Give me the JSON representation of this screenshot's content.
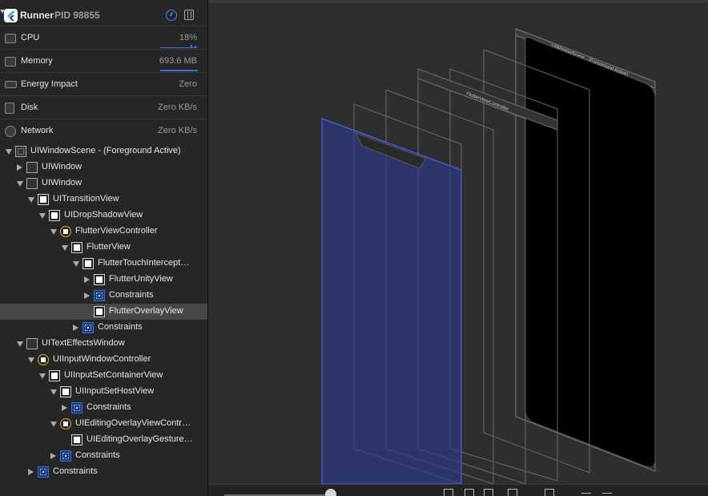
{
  "process": {
    "app_name": "Runner",
    "pid": "PID 98855",
    "app_icon": "flutter-icon"
  },
  "gauges": [
    {
      "name": "CPU",
      "value": "18%",
      "icon": "cpu-icon"
    },
    {
      "name": "Memory",
      "value": "693.6 MB",
      "icon": "memory-icon"
    },
    {
      "name": "Energy Impact",
      "value": "Zero",
      "icon": "battery-icon"
    },
    {
      "name": "Disk",
      "value": "Zero KB/s",
      "icon": "disk-icon"
    },
    {
      "name": "Network",
      "value": "Zero KB/s",
      "icon": "network-icon"
    }
  ],
  "tree": [
    {
      "label": "UIWindowScene - (Foreground Active)",
      "depth": 0,
      "disclosure": "down",
      "icon": "scene"
    },
    {
      "label": "UIWindow",
      "depth": 1,
      "disclosure": "right",
      "icon": "window"
    },
    {
      "label": "UIWindow",
      "depth": 1,
      "disclosure": "down",
      "icon": "window"
    },
    {
      "label": "UITransitionView",
      "depth": 2,
      "disclosure": "down",
      "icon": "view"
    },
    {
      "label": "UIDropShadowView",
      "depth": 3,
      "disclosure": "down",
      "icon": "view"
    },
    {
      "label": "FlutterViewController",
      "depth": 4,
      "disclosure": "down",
      "icon": "vc"
    },
    {
      "label": "FlutterView",
      "depth": 5,
      "disclosure": "down",
      "icon": "view"
    },
    {
      "label": "FlutterTouchIntercept…",
      "depth": 6,
      "disclosure": "down",
      "icon": "view"
    },
    {
      "label": "FlutterUnityView",
      "depth": 7,
      "disclosure": "right",
      "icon": "view"
    },
    {
      "label": "Constraints",
      "depth": 7,
      "disclosure": "right",
      "icon": "cons"
    },
    {
      "label": "FlutterOverlayView",
      "depth": 7,
      "disclosure": "none",
      "icon": "view",
      "selected": true
    },
    {
      "label": "Constraints",
      "depth": 6,
      "disclosure": "right",
      "icon": "cons"
    },
    {
      "label": "UITextEffectsWindow",
      "depth": 1,
      "disclosure": "down",
      "icon": "window",
      "depth_override": 0
    },
    {
      "label": "UIInputWindowController",
      "depth": 2,
      "disclosure": "down",
      "icon": "vc"
    },
    {
      "label": "UIInputSetContainerView",
      "depth": 3,
      "disclosure": "down",
      "icon": "view"
    },
    {
      "label": "UIInputSetHostView",
      "depth": 4,
      "disclosure": "down",
      "icon": "view"
    },
    {
      "label": "Constraints",
      "depth": 5,
      "disclosure": "right",
      "icon": "cons"
    },
    {
      "label": "UIEditingOverlayViewContr…",
      "depth": 4,
      "disclosure": "down",
      "icon": "vc"
    },
    {
      "label": "UIEditingOverlayGesture…",
      "depth": 5,
      "disclosure": "none",
      "icon": "view"
    },
    {
      "label": "Constraints",
      "depth": 4,
      "disclosure": "right",
      "icon": "cons"
    },
    {
      "label": "Constraints",
      "depth": 2,
      "disclosure": "right",
      "icon": "cons"
    }
  ],
  "canvas": {
    "scene_label": "UIWindowScene - (Foreground Active)",
    "controller_label": "FlutterViewController",
    "highlight_color": "#2c3a8c"
  }
}
